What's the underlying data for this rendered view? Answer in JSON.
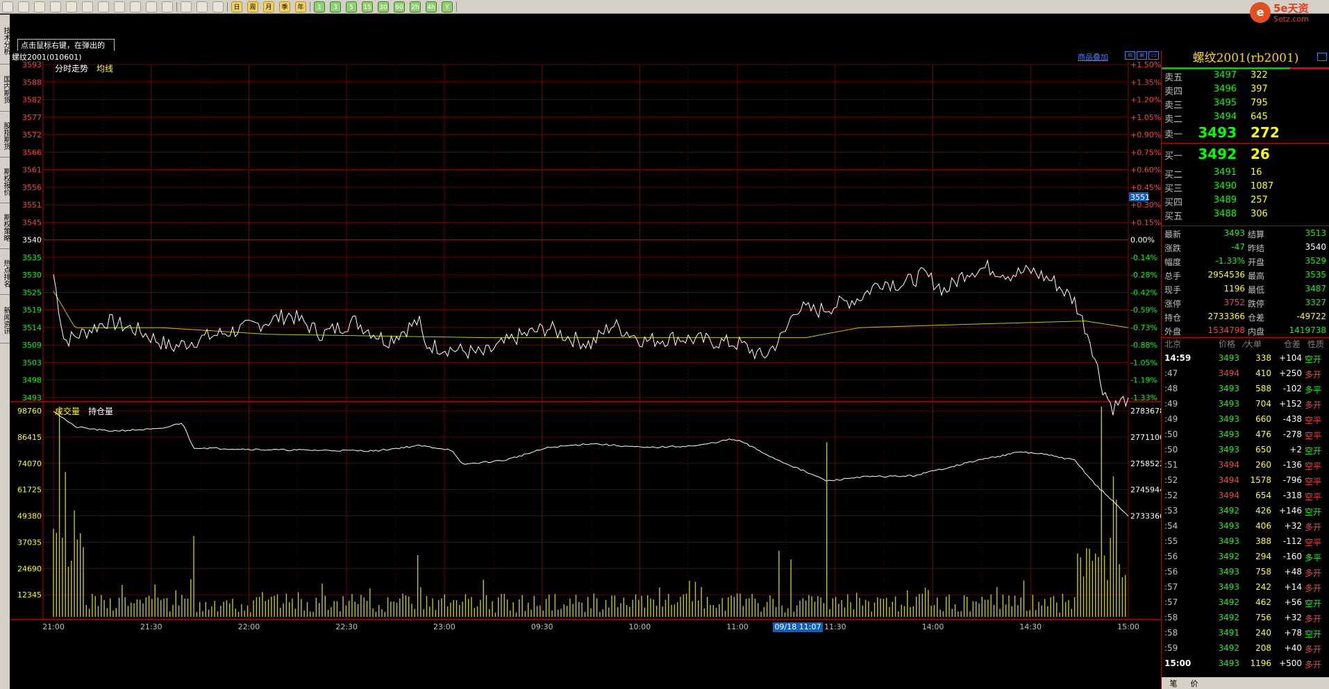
{
  "toolbar": {
    "groups": [
      {
        "kind": "icon",
        "items": [
          "back-icon",
          "home-icon",
          "folder-icon",
          "book-icon",
          "refresh-icon",
          "zoom-in-icon",
          "zoom-out-icon",
          "pen-icon",
          "brush-icon",
          "filter-icon",
          "split-icon"
        ]
      },
      {
        "kind": "icon",
        "items": [
          "table-icon",
          "line-chart-icon",
          "kline-icon"
        ]
      },
      {
        "kind": "period",
        "items": [
          "日",
          "周",
          "月",
          "季",
          "年"
        ]
      },
      {
        "kind": "minute",
        "items": [
          "1",
          "3",
          "5",
          "15",
          "30",
          "60",
          "2h",
          "4h",
          "Y"
        ]
      }
    ]
  },
  "logo": {
    "badge": "e",
    "brand": "5e天资",
    "url": "5etz.com"
  },
  "hint": {
    "text": "点击鼠标右键，在弹出的菜单中指定窗口内容。"
  },
  "left_tabs": [
    "技术分析",
    "国内期货",
    "股指期货",
    "期权报价",
    "期权策略",
    "热点排名",
    "新闻资讯"
  ],
  "chart": {
    "title": "螺纹2001(010601)",
    "overlay_button": "商品叠加",
    "ctrl_buttons": [
      "⊟",
      "⊞",
      "▭"
    ],
    "price_labels": {
      "tab": "分时走势",
      "ma": "均线"
    },
    "volume_labels": {
      "vol": "成交量",
      "oi": "持仓量"
    },
    "crosshair_price": "3551",
    "time_cursor": "09/18 11:07",
    "y_price": [
      "3593",
      "3588",
      "3582",
      "3577",
      "3572",
      "3566",
      "3561",
      "3556",
      "3551",
      "3545",
      "3540",
      "3535",
      "3530",
      "3525",
      "3519",
      "3514",
      "3509",
      "3503",
      "3498",
      "3493"
    ],
    "y_pct": [
      "+1.50%",
      "+1.35%",
      "+1.20%",
      "+1.05%",
      "+0.90%",
      "+0.75%",
      "+0.60%",
      "+0.45%",
      "+0.30%",
      "+0.15%",
      "0.00%",
      "-0.14%",
      "-0.28%",
      "-0.42%",
      "-0.59%",
      "-0.73%",
      "-0.88%",
      "-1.05%",
      "-1.19%",
      "-1.33%"
    ],
    "y_vol": [
      "98760",
      "86415",
      "74070",
      "61725",
      "49380",
      "37035",
      "24690",
      "12345"
    ],
    "y_oi": [
      "2783678",
      "2771100",
      "2758522",
      "2745944",
      "2733366"
    ],
    "x_times": [
      "21:00",
      "21:30",
      "22:00",
      "22:30",
      "23:00",
      "09:30",
      "10:00",
      "11:00",
      "11:30",
      "14:00",
      "14:30",
      "15:00"
    ],
    "colors": {
      "grid": "#8b0000",
      "price_line": "#ffffff",
      "avg_line": "#c8c800",
      "volume": "#c8c800",
      "up_label": "#ff4040",
      "down_label": "#00ff00"
    }
  },
  "quote": {
    "title": "螺纹2001(rb2001)",
    "asks": [
      {
        "label": "卖五",
        "price": "3497",
        "vol": "322"
      },
      {
        "label": "卖四",
        "price": "3496",
        "vol": "397"
      },
      {
        "label": "卖三",
        "price": "3495",
        "vol": "795"
      },
      {
        "label": "卖二",
        "price": "3494",
        "vol": "645"
      },
      {
        "label": "卖一",
        "price": "3493",
        "vol": "272"
      }
    ],
    "bids": [
      {
        "label": "买一",
        "price": "3492",
        "vol": "26"
      },
      {
        "label": "买二",
        "price": "3491",
        "vol": "16"
      },
      {
        "label": "买三",
        "price": "3490",
        "vol": "1087"
      },
      {
        "label": "买四",
        "price": "3489",
        "vol": "257"
      },
      {
        "label": "买五",
        "price": "3488",
        "vol": "306"
      }
    ],
    "stats": [
      {
        "l1": "最新",
        "v1": "3493",
        "c1": "#00ff00",
        "l2": "结算",
        "v2": "3513",
        "c2": "#00ff00"
      },
      {
        "l1": "涨跌",
        "v1": "-47",
        "c1": "#00ff00",
        "l2": "昨结",
        "v2": "3540",
        "c2": "#ffffff"
      },
      {
        "l1": "幅度",
        "v1": "-1.33%",
        "c1": "#00ff00",
        "l2": "开盘",
        "v2": "3529",
        "c2": "#00ff00"
      },
      {
        "l1": "总手",
        "v1": "2954536",
        "c1": "#ffff00",
        "l2": "最高",
        "v2": "3535",
        "c2": "#00ff00"
      },
      {
        "l1": "现手",
        "v1": "1196",
        "c1": "#ffff00",
        "l2": "最低",
        "v2": "3487",
        "c2": "#00ff00"
      },
      {
        "l1": "涨停",
        "v1": "3752",
        "c1": "#ff4040",
        "l2": "跌停",
        "v2": "3327",
        "c2": "#00ff00"
      },
      {
        "l1": "持仓",
        "v1": "2733366",
        "c1": "#ffff00",
        "l2": "仓差",
        "v2": "-49722",
        "c2": "#ffff00"
      },
      {
        "l1": "外盘",
        "v1": "1534798",
        "c1": "#ff4040",
        "l2": "内盘",
        "v2": "1419738",
        "c2": "#00ff00"
      }
    ],
    "tick_header": {
      "time": "北京",
      "price": "价格",
      "vol": "⁄大单",
      "oi": "仓差",
      "nature": "性质"
    },
    "ticks": [
      {
        "t": "14:59",
        "p": "3493",
        "v": "338",
        "c": "+104",
        "n": "空开",
        "pc": "#00ff00",
        "nc": "#00ff00"
      },
      {
        "t": ":47",
        "p": "3494",
        "v": "410",
        "c": "+250",
        "n": "多开",
        "pc": "#ff4040",
        "nc": "#ff4040"
      },
      {
        "t": ":48",
        "p": "3493",
        "v": "588",
        "c": "-102",
        "n": "多平",
        "pc": "#00ff00",
        "nc": "#00ff00"
      },
      {
        "t": ":49",
        "p": "3493",
        "v": "704",
        "c": "+152",
        "n": "多开",
        "pc": "#00ff00",
        "nc": "#ff4040"
      },
      {
        "t": ":49",
        "p": "3493",
        "v": "660",
        "c": "-438",
        "n": "空平",
        "pc": "#00ff00",
        "nc": "#ff4040"
      },
      {
        "t": ":50",
        "p": "3493",
        "v": "476",
        "c": "-278",
        "n": "空平",
        "pc": "#00ff00",
        "nc": "#ff4040"
      },
      {
        "t": ":50",
        "p": "3493",
        "v": "650",
        "c": "+2",
        "n": "空开",
        "pc": "#00ff00",
        "nc": "#00ff00"
      },
      {
        "t": ":51",
        "p": "3494",
        "v": "260",
        "c": "-136",
        "n": "空平",
        "pc": "#ff4040",
        "nc": "#ff4040"
      },
      {
        "t": ":52",
        "p": "3494",
        "v": "1578",
        "c": "-796",
        "n": "空平",
        "pc": "#ff4040",
        "nc": "#ff4040"
      },
      {
        "t": ":52",
        "p": "3494",
        "v": "654",
        "c": "-318",
        "n": "空平",
        "pc": "#ff4040",
        "nc": "#ff4040"
      },
      {
        "t": ":53",
        "p": "3492",
        "v": "426",
        "c": "+146",
        "n": "空开",
        "pc": "#00ff00",
        "nc": "#00ff00"
      },
      {
        "t": ":54",
        "p": "3493",
        "v": "406",
        "c": "+32",
        "n": "多开",
        "pc": "#00ff00",
        "nc": "#ff4040"
      },
      {
        "t": ":55",
        "p": "3493",
        "v": "388",
        "c": "-112",
        "n": "空平",
        "pc": "#00ff00",
        "nc": "#ff4040"
      },
      {
        "t": ":56",
        "p": "3492",
        "v": "294",
        "c": "-160",
        "n": "多平",
        "pc": "#00ff00",
        "nc": "#00ff00"
      },
      {
        "t": ":56",
        "p": "3493",
        "v": "758",
        "c": "+48",
        "n": "多开",
        "pc": "#00ff00",
        "nc": "#ff4040"
      },
      {
        "t": ":57",
        "p": "3493",
        "v": "242",
        "c": "+14",
        "n": "多开",
        "pc": "#00ff00",
        "nc": "#ff4040"
      },
      {
        "t": ":57",
        "p": "3492",
        "v": "462",
        "c": "+56",
        "n": "空开",
        "pc": "#00ff00",
        "nc": "#00ff00"
      },
      {
        "t": ":58",
        "p": "3492",
        "v": "756",
        "c": "+32",
        "n": "多开",
        "pc": "#00ff00",
        "nc": "#ff4040"
      },
      {
        "t": ":58",
        "p": "3491",
        "v": "240",
        "c": "+78",
        "n": "空开",
        "pc": "#00ff00",
        "nc": "#00ff00"
      },
      {
        "t": ":59",
        "p": "3492",
        "v": "208",
        "c": "+40",
        "n": "多开",
        "pc": "#00ff00",
        "nc": "#ff4040"
      },
      {
        "t": "15:00",
        "p": "3493",
        "v": "1196",
        "c": "+500",
        "n": "多开",
        "pc": "#00ff00",
        "nc": "#ff4040"
      }
    ],
    "bottom_tabs": [
      "笔",
      "价"
    ]
  }
}
